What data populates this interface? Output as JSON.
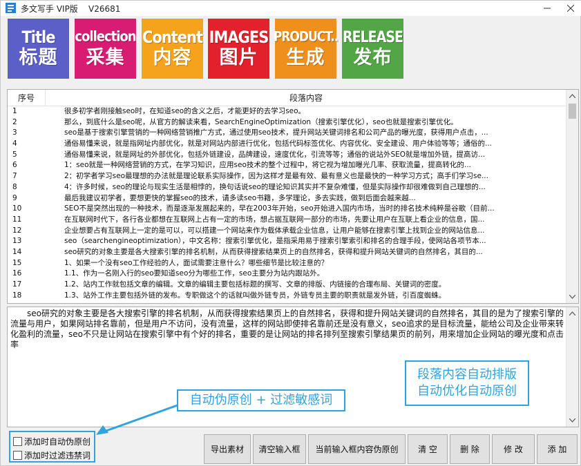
{
  "window": {
    "title": "多文写手 VIP版    V26681",
    "colors": {
      "accent": "#2ea3e0"
    }
  },
  "toolbar": {
    "tiles": [
      {
        "en": "Title",
        "zh": "标题",
        "color": "#5b5fc7"
      },
      {
        "en": "collection",
        "zh": "采集",
        "color": "#d81b73"
      },
      {
        "en": "Content",
        "zh": "内容",
        "color": "#f5a21c"
      },
      {
        "en": "IMAGES",
        "zh": "图片",
        "color": "#e2212d"
      },
      {
        "en": "PRODUCT..",
        "zh": "生成",
        "color": "#f0901c"
      },
      {
        "en": "RELEASE",
        "zh": "发布",
        "color": "#52a645"
      }
    ]
  },
  "table": {
    "headers": {
      "num": "序号",
      "content": "段落内容"
    },
    "rows": [
      {
        "num": "1",
        "text": "很多初学者刚接触seo时，在知道seo的含义之后，才能更好的去学习seo。"
      },
      {
        "num": "2",
        "text": "那么，到底什么是seo呢，从官方的解读来看，SearchEngineOptimization（搜索引擎优化），seo也就是搜索引擎优化。"
      },
      {
        "num": "3",
        "text": "seo是基于搜索引擎营销的一种网络营销推广方式，通过使用seo技术，提升网站关键词排名和公司产品的曝光度，获得用户点击，..."
      },
      {
        "num": "4",
        "text": "通俗易懂来说，就是指网址内部优化，就是对网站内部进行优化，包括代码标签优化、内容优化、安全建设、用户体验等等；通俗的..."
      },
      {
        "num": "5",
        "text": "通俗易懂来说，就是网址的外部优化，包括外链建设，品牌建设，速度优化，引流等等；通俗的说站外SEO就是增加外链，提高访..."
      },
      {
        "num": "6",
        "text": "1：seo就是一种网络营销的方式，在学习知识，应用seo技术的整个过程中，将它视为增加曝光几率、获取流量，提高转化的..."
      },
      {
        "num": "7",
        "text": "2：初学者学习seo最理想的办法就是理论联系实际操作，因为这样才是最有效、最有意义也是最快的一种学习方式；高手们学习se..."
      },
      {
        "num": "8",
        "text": "4：许多时候，seo的理论与现实生活是相悖的，换句话说seo的理论知识其实并不复杂难懂，但是实际操作却很难做到自己理想的..."
      },
      {
        "num": "9",
        "text": "最后我建议初学者，要想更快的掌握seo的技术，请多读seo书籍，多学理论，多去实践，做到后面会越来越..."
      },
      {
        "num": "10",
        "text": "SEO不是突然出现的一种技术，而是逐渐发展起来的，早在2003年开始，seo开始进入国内市场，当时的排名技术纯粹是谷歌（目前..."
      },
      {
        "num": "11",
        "text": "在互联网时代下，各行各业都想在互联网上占有一定的市场，想占据互联网一部分的市场，先要让用户在互联上看企业的信息，国..."
      },
      {
        "num": "12",
        "text": "企业想要占有互联网上一定的是可以，可以搭建一个网站来作为载体承载企业信息，让用户能够在搜索引擎上找到企业的网站信息..."
      },
      {
        "num": "13",
        "text": "seo（searchengineoptimization），中文名称：搜索引擎优化，是指采用易于搜索引擎索引和排名的合理手段，使网站各项节本..."
      },
      {
        "num": "14",
        "text": "seo研究的对象主要是各大搜索引擎的排名机制，从而获得搜索结果页上的自然排名，获得和提升网站关键词的自然排名，其目的..."
      },
      {
        "num": "15",
        "text": "1、如果一个没有seo工作经验的人，面试需要注意什么？哪些细节是比较注意的？"
      },
      {
        "num": "16",
        "text": "1.1、作为一名刚入行的seo要知道seo分为哪些工作，seo主要分为站内跟站外。"
      },
      {
        "num": "17",
        "text": "1.2、站内工作就包括文章的编辑。文章的编辑主要包括标题的撰写、文章的排版、内链接的合理布局、关键词的密度。"
      },
      {
        "num": "18",
        "text": "1.3、站外工作主要包括外链的发布。专职做这个的话就叫做外链专员，外链专员主要的职责就是发外链，引百度蜘蛛。"
      }
    ]
  },
  "editor": {
    "text": "seo研究的对象主要是各大搜索引擎的排名机制，从而获得搜索结果页上的自然排名，获得和提升网站关键词的自然排名，其目的是为了搜索引擎的流量与用户，如果网站排名靠前，但是用户不访问，没有流量，这样的网站即使排名靠前还是没有意义，seo追求的是目标流量，能给公司及企业带来转化盈利的流量，seo不只是让网站在搜索引擎中有个好的排名，重要的是让网站的排名排列至搜索引擎结果页的前列，用来增加企业网站的曝光度和点击率"
  },
  "callouts": {
    "right_line1": "段落内容自动排版",
    "right_line2": "自动优化自动原创",
    "left": "自动伪原创 + 过滤敏感词"
  },
  "options": {
    "auto_pseudo": {
      "label": "添加时自动伪原创",
      "checked": false
    },
    "filter_words": {
      "label": "添加时过滤违禁词",
      "checked": false
    }
  },
  "buttons": {
    "export": "导出素材",
    "clear_input": "清空输入框",
    "pseudo_current": "当前输入框内容伪原创",
    "clear": "清 空",
    "delete": "删 除",
    "modify": "修 改",
    "add": "添 加"
  }
}
